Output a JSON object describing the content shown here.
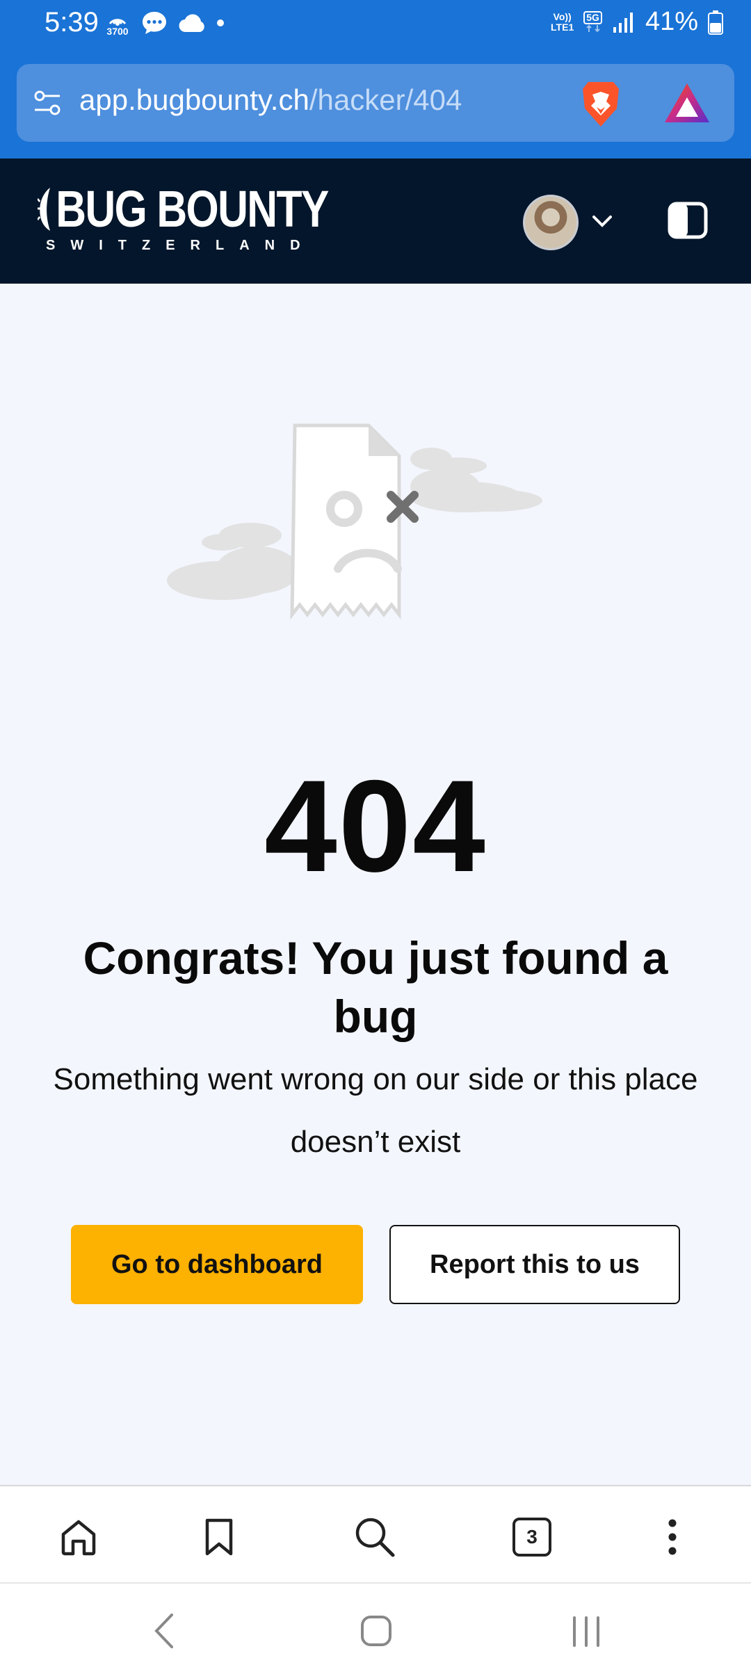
{
  "status_bar": {
    "time": "5:39",
    "hotspot_count": "3700",
    "volte_label": "Vo))",
    "lte_label": "LTE1",
    "network": "5G",
    "battery": "41%"
  },
  "browser": {
    "url_host": "app.bugbounty.ch",
    "url_path": "/hacker/404",
    "tab_count": "3"
  },
  "site": {
    "logo_main": "BUG BOUNTY",
    "logo_sub": "SWITZERLAND"
  },
  "error": {
    "code": "404",
    "title": "Congrats! You just found a bug",
    "description": "Something went wrong on our side or this place doesn’t exist"
  },
  "actions": {
    "primary_label": "Go to dashboard",
    "secondary_label": "Report this to us"
  },
  "colors": {
    "status_bar": "#1a73d6",
    "header_bg": "#04162b",
    "page_bg": "#f3f6fd",
    "primary_button": "#fdb100"
  },
  "icons": {
    "url_bar": "tune-icon",
    "brave": "brave-lion-icon",
    "rewards": "brave-rewards-icon",
    "bottom_bar": [
      "home-icon",
      "bookmark-icon",
      "search-icon",
      "tabs-icon",
      "more-vert-icon"
    ],
    "nav": [
      "back-icon",
      "home-circle-icon",
      "recents-icon"
    ]
  }
}
